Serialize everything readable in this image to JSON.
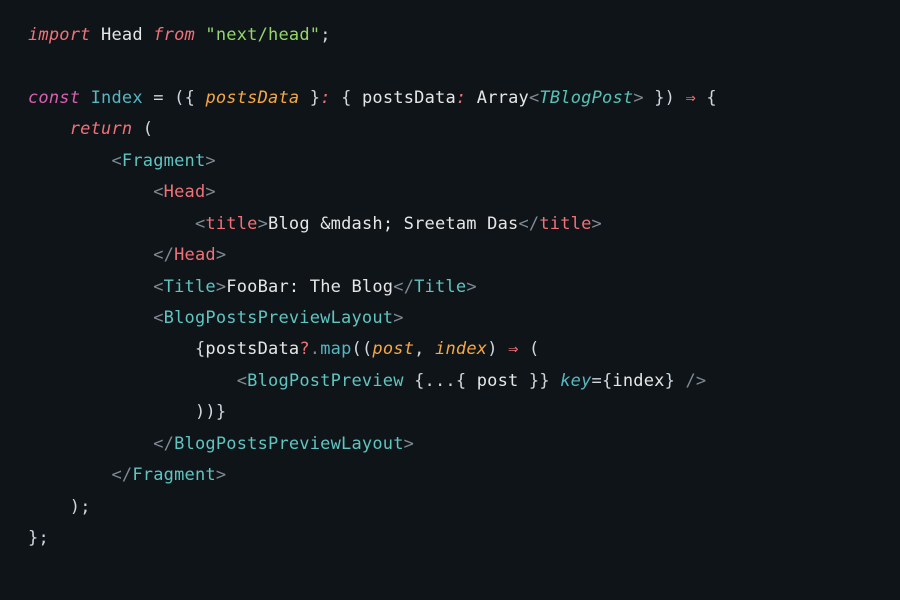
{
  "colors": {
    "bg": "#0f1419",
    "pink": "#f07178",
    "magenta": "#d85fb0",
    "white": "#e6e6e6",
    "blue": "#56b6c2",
    "orange": "#f5a742",
    "green": "#94d66a",
    "teal": "#5fc5c1",
    "cyan": "#56c2b6",
    "dim": "#7f8a94"
  },
  "t": {
    "import": "import",
    "Head": "Head",
    "from": "from",
    "nextHead": "\"next/head\"",
    "semi": ";",
    "const": "const",
    "Index": "Index",
    "eq": " = ",
    "lp": "(",
    "rp": ")",
    "lb": "{",
    "rb": "}",
    "postsData": "postsData",
    "colon": ":",
    "Array": "Array",
    "lt": "<",
    "gt": ">",
    "TBlogPost": "TBlogPost",
    "arrow": "⇒",
    "return": "return",
    "Fragment": "Fragment",
    "HeadTag": "Head",
    "titleTag": "title",
    "blogTitleText": "Blog &mdash; Sreetam Das",
    "slash": "/",
    "TitleTag": "Title",
    "fooBarText": "FooBar: The Blog",
    "BlogPostsPreviewLayout": "BlogPostsPreviewLayout",
    "opchain": "?",
    "dot": ".",
    "map": "map",
    "post": "post",
    "comma": ",",
    "index": "index",
    "BlogPostPreview": "BlogPostPreview",
    "spread": "...",
    "key": "key",
    "selfclose": " />"
  }
}
